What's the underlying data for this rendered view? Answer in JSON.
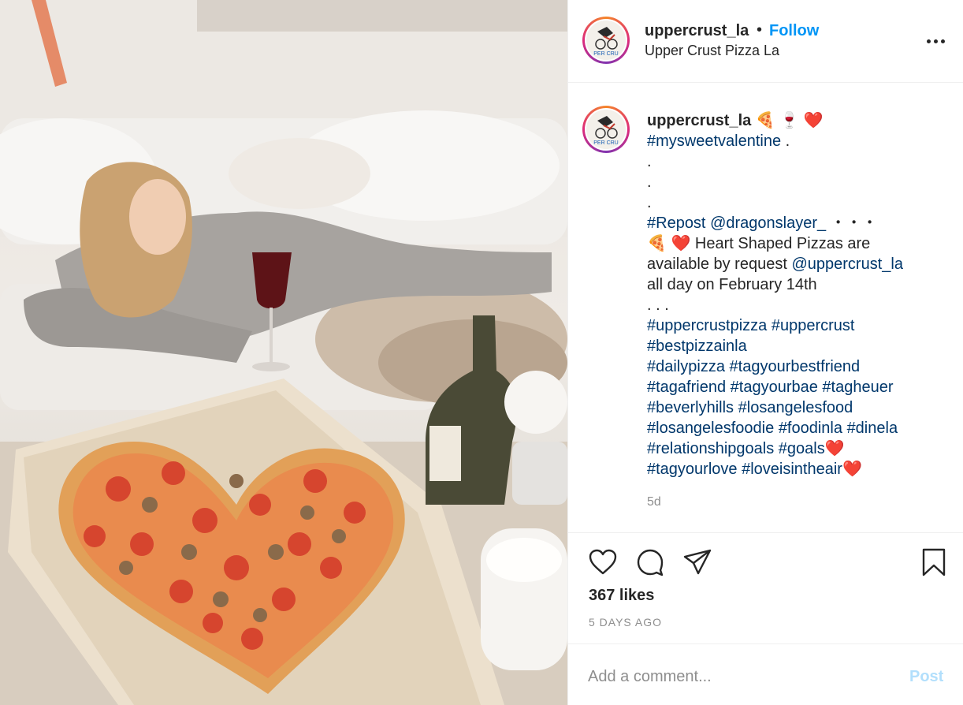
{
  "post": {
    "username": "uppercrust_la",
    "separator": "•",
    "follow_label": "Follow",
    "location": "Upper Crust Pizza La",
    "avatar_text": "PER CRU",
    "more_icon": "more-horizontal-icon"
  },
  "caption": {
    "username": "uppercrust_la",
    "emoji_line1": "🍕 🍷 ❤️",
    "hashtag_valentine": "#mysweetvalentine",
    "after_valentine": " .",
    "dot1": ".",
    "dot2": ".",
    "dot3": ".",
    "repost_tag": "#Repost",
    "repost_mention": "@dragonslayer_",
    "repost_suffix": " ・・・",
    "body_emojis": "🍕 ❤️",
    "body_text1": " Heart Shaped Pizzas are",
    "body_text2": "available by request ",
    "body_mention": "@uppercrust_la",
    "body_text3": "all day on February 14th",
    "ellipsis": ". . .",
    "hashtag_lines": [
      [
        "#uppercrustpizza",
        "#uppercrust"
      ],
      [
        "#bestpizzainla"
      ],
      [
        "#dailypizza",
        "#tagyourbestfriend"
      ],
      [
        "#tagafriend",
        "#tagyourbae",
        "#tagheuer"
      ],
      [
        "#beverlyhills",
        "#losangelesfood"
      ],
      [
        "#losangelesfoodie",
        "#foodinla",
        "#dinela"
      ],
      [
        "#relationshipgoals",
        "#goals❤️"
      ],
      [
        "#tagyourlove",
        "#loveisintheair❤️"
      ]
    ],
    "time_ago": "5d"
  },
  "actions": {
    "like_icon": "heart-icon",
    "comment_icon": "comment-icon",
    "share_icon": "send-icon",
    "save_icon": "bookmark-icon"
  },
  "likes": "367 likes",
  "posted": "5 DAYS AGO",
  "comment": {
    "placeholder": "Add a comment...",
    "post_label": "Post"
  },
  "colors": {
    "link_blue": "#0095f6",
    "hashtag_blue": "#00376b",
    "post_disabled": "#b2dffc",
    "muted": "#8e8e8e"
  }
}
